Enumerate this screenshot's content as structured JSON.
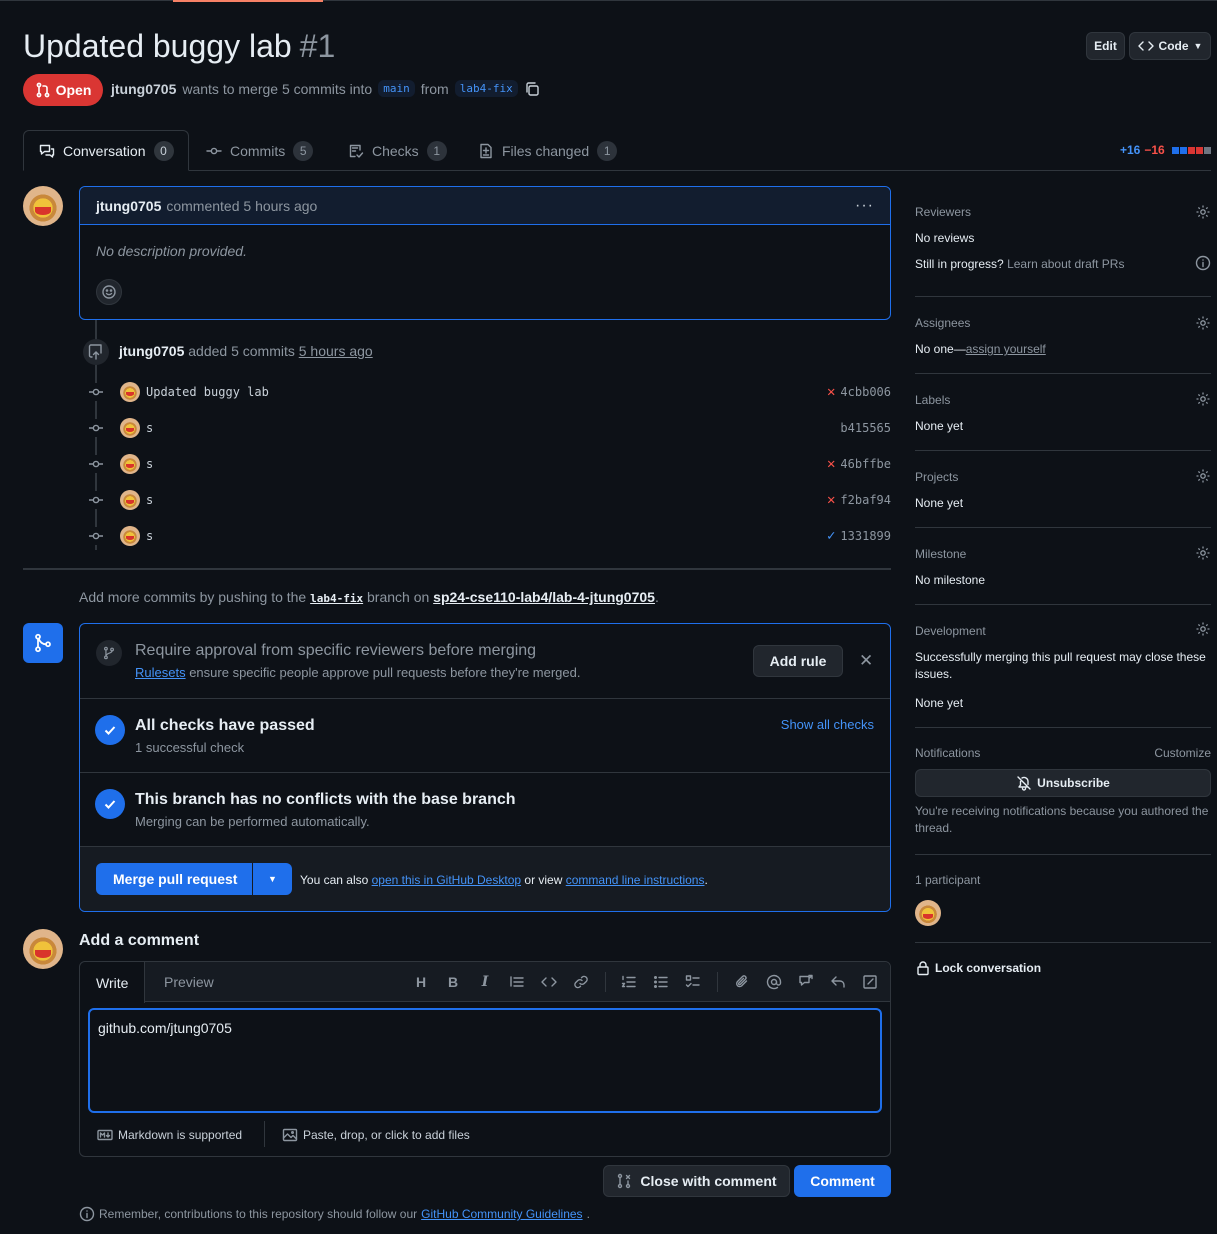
{
  "pr": {
    "title": "Updated buggy lab",
    "number": "#1",
    "state": "Open",
    "author": "jtung0705",
    "merge_text": "wants to merge 5 commits into",
    "base_branch": "main",
    "from_text": "from",
    "head_branch": "lab4-fix"
  },
  "header_buttons": {
    "edit": "Edit",
    "code": "Code"
  },
  "tabs": [
    {
      "label": "Conversation",
      "count": "0"
    },
    {
      "label": "Commits",
      "count": "5"
    },
    {
      "label": "Checks",
      "count": "1"
    },
    {
      "label": "Files changed",
      "count": "1"
    }
  ],
  "diffstat": {
    "additions": "+16",
    "deletions": "−16"
  },
  "comment": {
    "author": "jtung0705",
    "action": "commented 5 hours ago",
    "body": "No description provided."
  },
  "commits_event": {
    "author": "jtung0705",
    "action": "added 5 commits",
    "time": "5 hours ago"
  },
  "commits": [
    {
      "message": "Updated buggy lab",
      "sha": "4cbb006",
      "status": "fail"
    },
    {
      "message": "s",
      "sha": "b415565",
      "status": "none"
    },
    {
      "message": "s",
      "sha": "46bffbe",
      "status": "fail"
    },
    {
      "message": "s",
      "sha": "f2baf94",
      "status": "fail"
    },
    {
      "message": "s",
      "sha": "1331899",
      "status": "pass"
    }
  ],
  "push_hint": {
    "prefix": "Add more commits by pushing to the",
    "branch": "lab4-fix",
    "mid": "branch on",
    "repo": "sp24-cse110-lab4/lab-4-jtung0705",
    "suffix": "."
  },
  "merge_box": {
    "rule_title": "Require approval from specific reviewers before merging",
    "rule_link": "Rulesets",
    "rule_desc": "ensure specific people approve pull requests before they're merged.",
    "add_rule": "Add rule",
    "checks_title": "All checks have passed",
    "checks_sub": "1 successful check",
    "show_checks": "Show all checks",
    "conflict_title": "This branch has no conflicts with the base branch",
    "conflict_sub": "Merging can be performed automatically.",
    "merge_button": "Merge pull request",
    "also_text": "You can also",
    "desktop_link": "open this in GitHub Desktop",
    "or_view": "or view",
    "cli_link": "command line instructions",
    "period": "."
  },
  "add_comment": {
    "heading": "Add a comment",
    "write_tab": "Write",
    "preview_tab": "Preview",
    "value": "github.com/jtung0705",
    "markdown_note": "Markdown is supported",
    "files_note": "Paste, drop, or click to add files",
    "close_button": "Close with comment",
    "comment_button": "Comment",
    "remember_prefix": "Remember, contributions to this repository should follow our",
    "guidelines_link": "GitHub Community Guidelines",
    "remember_suffix": "."
  },
  "sidebar": {
    "reviewers_title": "Reviewers",
    "reviewers_value": "No reviews",
    "draft_question": "Still in progress?",
    "draft_link": "Learn about draft PRs",
    "assignees_title": "Assignees",
    "assignees_value": "No one—",
    "assign_link": "assign yourself",
    "labels_title": "Labels",
    "labels_value": "None yet",
    "projects_title": "Projects",
    "projects_value": "None yet",
    "milestone_title": "Milestone",
    "milestone_value": "No milestone",
    "development_title": "Development",
    "development_desc": "Successfully merging this pull request may close these issues.",
    "development_value": "None yet",
    "notifications_title": "Notifications",
    "customize": "Customize",
    "unsubscribe": "Unsubscribe",
    "notif_reason": "You're receiving notifications because you authored the thread.",
    "participants": "1 participant",
    "lock": "Lock conversation"
  },
  "colors": {
    "accent": "#1f6feb",
    "open": "#da3633",
    "fail": "#f85149",
    "link": "#4493f8"
  }
}
